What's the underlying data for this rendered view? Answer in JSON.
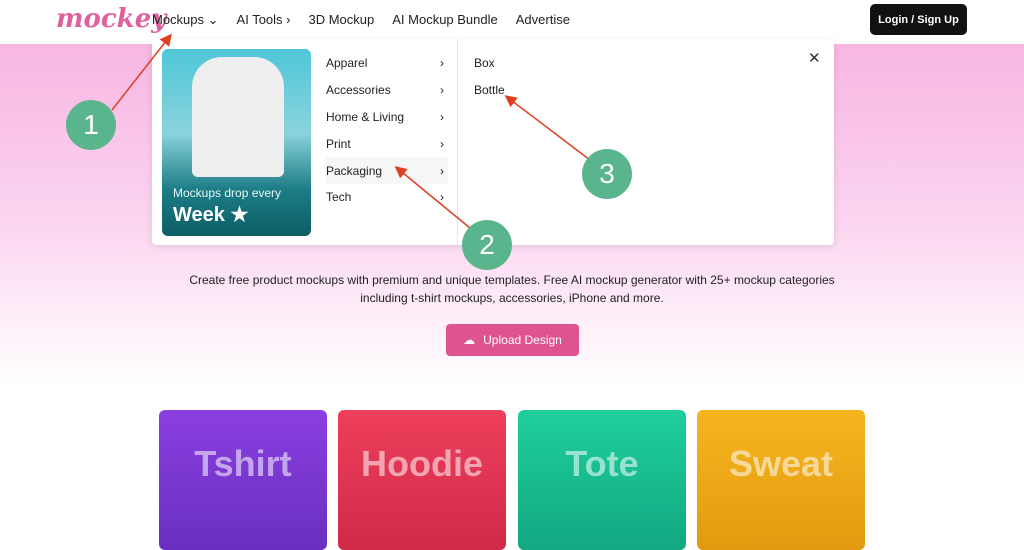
{
  "logo": "mockey",
  "nav": {
    "items": [
      "Mockups ⌄",
      "AI Tools ›",
      "3D Mockup",
      "AI Mockup Bundle",
      "Advertise"
    ],
    "login": "Login / Sign Up"
  },
  "dropdown": {
    "promo": {
      "line1": "Mockups drop every",
      "line2": "Week ★"
    },
    "categories": [
      "Apparel",
      "Accessories",
      "Home & Living",
      "Print",
      "Packaging",
      "Tech"
    ],
    "active_category": "Packaging",
    "subitems": [
      "Box",
      "Bottle"
    ],
    "close": "✕"
  },
  "hero": {
    "description": "Create free product mockups with premium and unique templates. Free AI mockup generator with 25+ mockup categories including t-shirt mockups, accessories, iPhone and more.",
    "upload": "Upload Design"
  },
  "cards": [
    {
      "label": "Tshirt",
      "color": "#8a3fe0"
    },
    {
      "label": "Hoodie",
      "color": "#ee3f5c"
    },
    {
      "label": "Tote",
      "color": "#1fcf9b"
    },
    {
      "label": "Sweat",
      "color": "#f6b51e"
    }
  ],
  "annotations": [
    "1",
    "2",
    "3"
  ]
}
